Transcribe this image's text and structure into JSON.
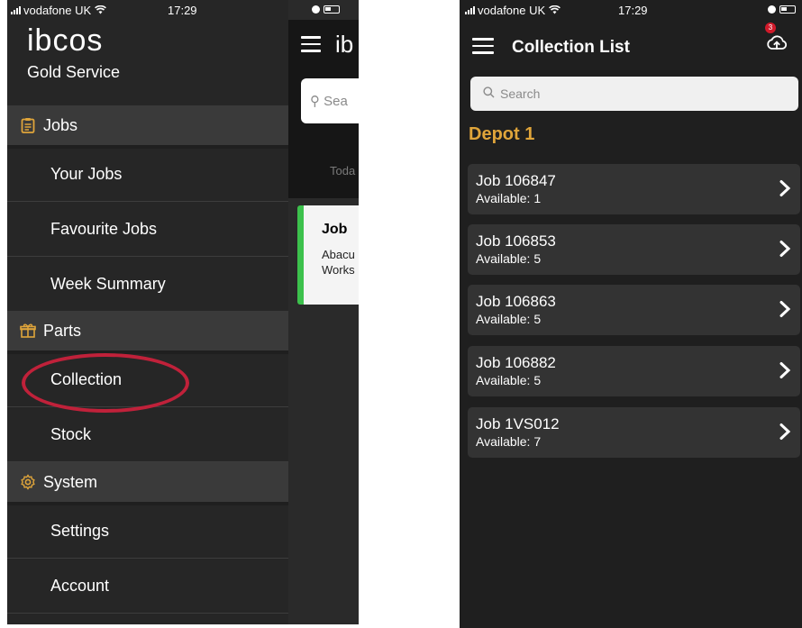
{
  "left_screen": {
    "status": {
      "carrier": "vodafone UK",
      "time": "17:29"
    },
    "logo": "ibcos",
    "subtitle": "Gold Service",
    "sections": [
      {
        "label": "Jobs",
        "icon": "clipboard-icon",
        "items": [
          "Your Jobs",
          "Favourite Jobs",
          "Week Summary"
        ]
      },
      {
        "label": "Parts",
        "icon": "package-icon",
        "items": [
          "Collection",
          "Stock"
        ]
      },
      {
        "label": "System",
        "icon": "gear-icon",
        "items": [
          "Settings",
          "Account"
        ]
      }
    ],
    "underlay": {
      "title_fragment": "ib",
      "search_fragment": "Sea",
      "tab_fragment": "Toda",
      "card_title": "Job",
      "card_line1": "Abacu",
      "card_line2": "Works"
    },
    "highlight_color": "#c0213a"
  },
  "right_screen": {
    "status": {
      "carrier": "vodafone UK",
      "time": "17:29"
    },
    "title": "Collection List",
    "upload_badge": "3",
    "search_placeholder": "Search",
    "depot": "Depot 1",
    "accent_color": "#e0a53a",
    "jobs": [
      {
        "title": "Job 106847",
        "available": "Available: 1"
      },
      {
        "title": "Job 106853",
        "available": "Available: 5"
      },
      {
        "title": "Job 106863",
        "available": "Available: 5"
      },
      {
        "title": "Job 106882",
        "available": "Available: 5"
      },
      {
        "title": "Job 1VS012",
        "available": "Available: 7"
      }
    ]
  }
}
